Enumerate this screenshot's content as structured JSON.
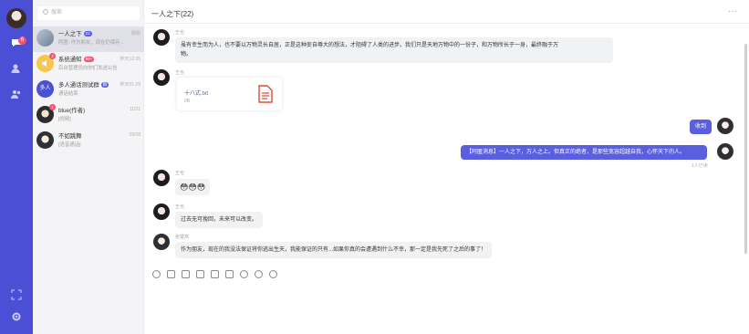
{
  "search": {
    "placeholder": "搜索"
  },
  "conversations": [
    {
      "title": "一人之下",
      "badge": "22",
      "sub": "阿匿: 作为朋友，现在仍保存...",
      "time": "刚刚",
      "selected": true
    },
    {
      "title": "系统通知",
      "badge": "99+",
      "sub": "后台管理员向你们发送公告",
      "time": "昨天12:35",
      "count": "2"
    },
    {
      "title": "多人通话测试群",
      "badge": "群",
      "sub": "通话结束",
      "time": "昨天01:29",
      "avatar_text": "多人"
    },
    {
      "title": "blue(作者)",
      "sub": "[视频]",
      "time": "11/21",
      "count": "1"
    },
    {
      "title": "不如跳舞",
      "sub": "[语音通话]",
      "time": "09/28"
    }
  ],
  "chat": {
    "title": "一人之下(22)",
    "more": "···",
    "messages": [
      {
        "name": "王也",
        "text_1": "虽有幸生而为人，也不要以万物灵长自居，正是这种妄自尊大的想法，才阻碍了人类的进步。我们只是天地万物中的一份子，和万物所长于一身，最终融于万",
        "text_2": "物。"
      },
      {
        "name": "王也",
        "file_name": "十八式.txt",
        "file_size": "0B"
      },
      {
        "text": "收到"
      },
      {
        "text": "【阿匿消息】一人之下，万人之上。但真正的绝者，是那些宽容超越自我，心怀天下的人。",
        "read": "1人已读"
      },
      {
        "name": "王也",
        "emoji": "😳😳😳"
      },
      {
        "name": "王也",
        "text": "过去无可挽回，未来可以改变。"
      },
      {
        "name": "张楚岚",
        "text": "作为朋友，现在的我没法保证将你逃出生天，我能保证的只有...如果你真的会遭遇到什么不幸，那一定是我先死了之后的事了！"
      }
    ]
  },
  "colors": {
    "accent": "#5a5fe0",
    "rail": "#4a4fd6",
    "badge": "#f0546e"
  }
}
